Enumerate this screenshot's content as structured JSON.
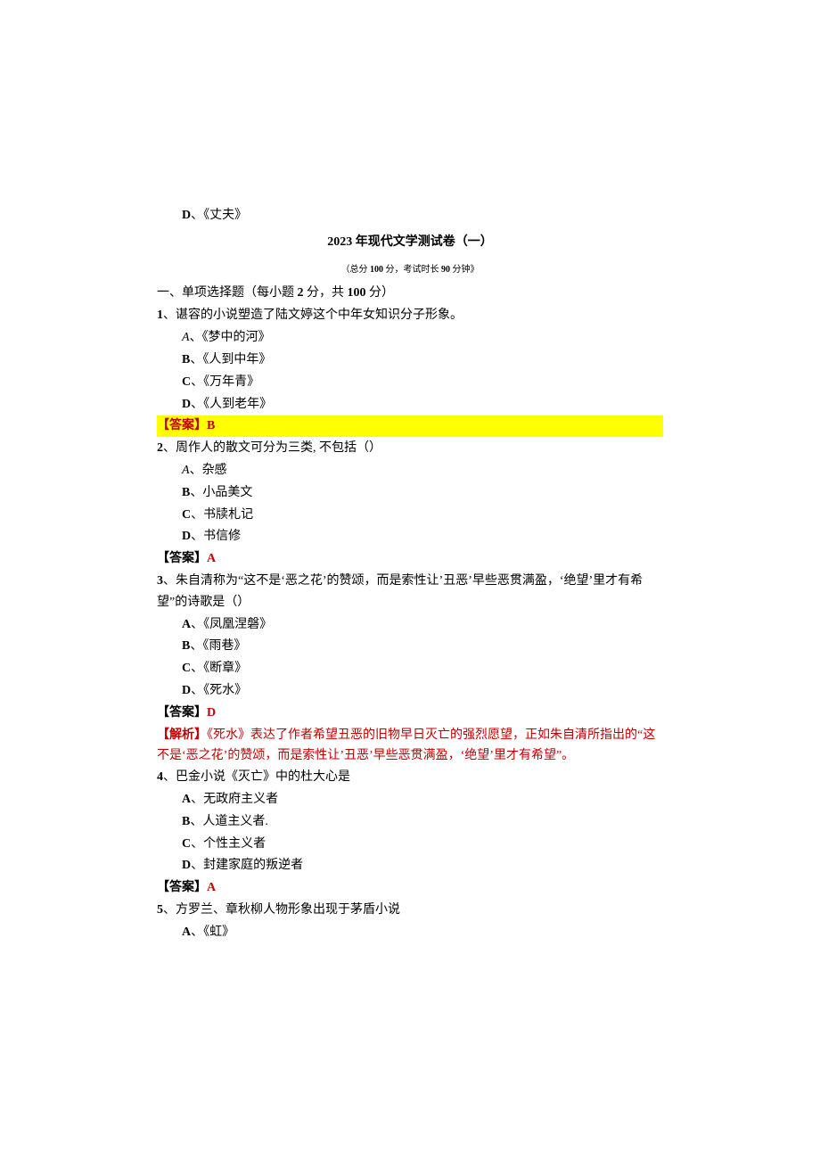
{
  "orphan": {
    "label": "D",
    "sep": "、",
    "text": "《丈夫》"
  },
  "title": {
    "year": "2023",
    "rest": " 年现代文学测试卷（一）"
  },
  "subtitle": {
    "open": "（总分",
    "score": " 100 ",
    "mid": "分，考试时长",
    "time": " 90 ",
    "end": "分钟》"
  },
  "section": {
    "prefix": "一、单项选择题（每小题",
    "pts": " 2 ",
    "mid": "分，共",
    "total": " 100 ",
    "suffix": "分）"
  },
  "q1": {
    "num": "1",
    "sep": "、",
    "text": "谌容的小说塑造了陆文婷这个中年女知识分子形象。",
    "a_label": "A",
    "a_sep": "、",
    "a_text": "《梦中的河》",
    "b_label": "B",
    "b_sep": "、",
    "b_text": "《人到中年》",
    "c_label": "C",
    "c_sep": "、",
    "c_text": "《万年青》",
    "d_label": "D",
    "d_sep": "、",
    "d_text": "《人到老年》",
    "ans_label": "【答案】",
    "ans_value": "B"
  },
  "q2": {
    "num": "2",
    "sep": "、",
    "text": "周作人的散文可分为三类, 不包括（）",
    "a_label": "A",
    "a_sep": "、",
    "a_text": "杂感",
    "b_label": "B",
    "b_sep": "、",
    "b_text": "小品美文",
    "c_label": "C",
    "c_sep": "、",
    "c_text": "书牍札记",
    "d_label": "D",
    "d_sep": "、",
    "d_text": "书信修",
    "ans_label": "【答案】",
    "ans_value": "A"
  },
  "q3": {
    "num": "3",
    "sep": "、",
    "text": "朱自清称为“这不是‘恶之花’的赞颂，而是索性让’丑恶’早些恶贯满盈，‘绝望’里才有希望”的诗歌是（）",
    "a_label": "A",
    "a_sep": "、",
    "a_text": "《凤凰涅磐》",
    "b_label": "B",
    "b_sep": "、",
    "b_text": "《雨巷》",
    "c_label": "C",
    "c_sep": "、",
    "c_text": "《断章》",
    "d_label": "D",
    "d_sep": "、",
    "d_text": "《死水》",
    "ans_label": "【答案】",
    "ans_value": "D",
    "ana_label": "【解析】",
    "ana_text": "《死水》表达了作者希望丑恶的旧物早日灭亡的强烈愿望，正如朱自清所指出的“这不是‘恶之花’的赞颂，而是索性让’丑恶’早些恶贯满盈，‘绝望’里才有希望”。"
  },
  "q4": {
    "num": "4",
    "sep": "、",
    "text": "巴金小说《灭亡》中的杜大心是",
    "a_label": "A",
    "a_sep": "、",
    "a_text": "无政府主义者",
    "b_label": "B",
    "b_sep": "、",
    "b_text": "人道主义者.",
    "c_label": "C",
    "c_sep": "、",
    "c_text": "个性主义者",
    "d_label": "D",
    "d_sep": "、",
    "d_text": "封建家庭的叛逆者",
    "ans_label": "【答案】",
    "ans_value": "A"
  },
  "q5": {
    "num": "5",
    "sep": "、",
    "text": "方罗兰、章秋柳人物形象出现于茅盾小说",
    "a_label": "A",
    "a_sep": "、",
    "a_text": "《虹》"
  }
}
